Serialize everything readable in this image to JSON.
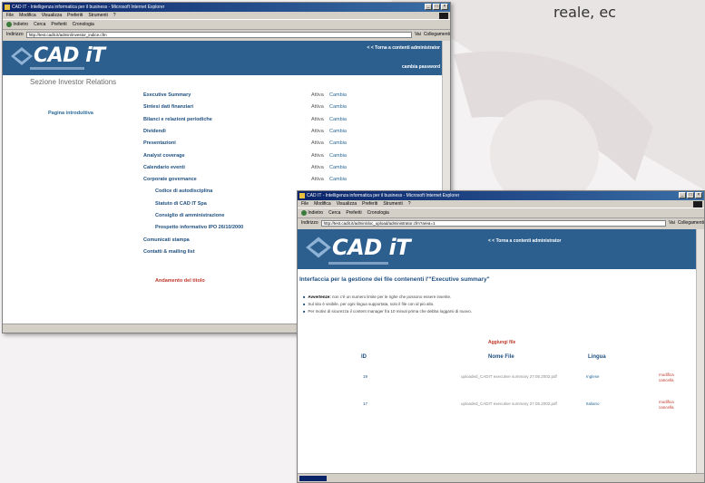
{
  "caption": "reale, ec",
  "browser": {
    "title": "CAD IT - Intelligenza informatica per il business - Microsoft Internet Explorer",
    "menus": [
      "File",
      "Modifica",
      "Visualizza",
      "Preferiti",
      "Strumenti",
      "?"
    ],
    "toolbar": {
      "back": "Indietro",
      "search": "Cerca",
      "favorites": "Preferiti",
      "history": "Cronologia"
    },
    "address_label": "Indirizzo",
    "go": "Vai",
    "links": "Collegamenti"
  },
  "window1": {
    "url": "http://test.cadit.it/admin/investor_indice.cfm",
    "logo": "CAD iT",
    "header_link": "< < Torna a contenti administrator",
    "change_password": "cambia password",
    "section_label": "Sezione Investor Relations",
    "intro_link": "Pagina introduttiva",
    "status": "Attiva",
    "action": "Cambia",
    "menu": [
      {
        "label": "Executive Summary",
        "indent": 0
      },
      {
        "label": "Sintesi dati finanziari",
        "indent": 0
      },
      {
        "label": "Bilanci e relazioni periodiche",
        "indent": 0
      },
      {
        "label": "Dividendi",
        "indent": 0
      },
      {
        "label": "Presentazioni",
        "indent": 0
      },
      {
        "label": "Analyst coverage",
        "indent": 0
      },
      {
        "label": "Calendario eventi",
        "indent": 0
      },
      {
        "label": "Corporate governance",
        "indent": 0
      },
      {
        "label": "Codice di autodisciplina",
        "indent": 1
      },
      {
        "label": "Statuto di CAD IT Spa",
        "indent": 1
      },
      {
        "label": "Consiglio di amministrazione",
        "indent": 1
      },
      {
        "label": "Prospetto informativo IPO 26/10/2000",
        "indent": 1
      },
      {
        "label": "Comunicati stampa",
        "indent": 0
      },
      {
        "label": "Contatti & mailing list",
        "indent": 0
      }
    ],
    "trend_link": "Andamento del titolo"
  },
  "window2": {
    "url": "http://test.cadit.it/admin/doc_upload/administrator.cfm?area=1",
    "logo": "CAD iT",
    "header_link": "< < Torna a contenti administrator",
    "title": "Interfaccia per la gestione dei file contenenti l'\"Executive summary\"",
    "notes": [
      {
        "bold": "Avvertenze:",
        "text": " non c'è un numero limite per le righe che possono essere inserite."
      },
      {
        "bold": "",
        "text": "Sul sito è visibile, per ogni lingua supportata, solo il file con id più alto."
      },
      {
        "bold": "",
        "text": "Per motivi di sicurezza il content manager fra 10 minuti prima che debba loggarsi di nuovo."
      }
    ],
    "add_file": "Aggiungi file",
    "columns": {
      "id": "ID",
      "name": "Nome File",
      "lang": "Lingua"
    },
    "rows": [
      {
        "id": "19",
        "file": "uploaded_CADIT executive summary 27.05.2002.pdf",
        "lang": "Inglese",
        "edit": "modifica",
        "delete": "cancella"
      },
      {
        "id": "17",
        "file": "uploaded_CADIT executive summary 27.05.2002.pdf",
        "lang": "Italiano",
        "edit": "modifica",
        "delete": "cancella"
      }
    ]
  },
  "colors": {
    "header_blue": "#2c5f8e",
    "link_blue": "#1e4f80",
    "accent_red": "#c0392b"
  }
}
